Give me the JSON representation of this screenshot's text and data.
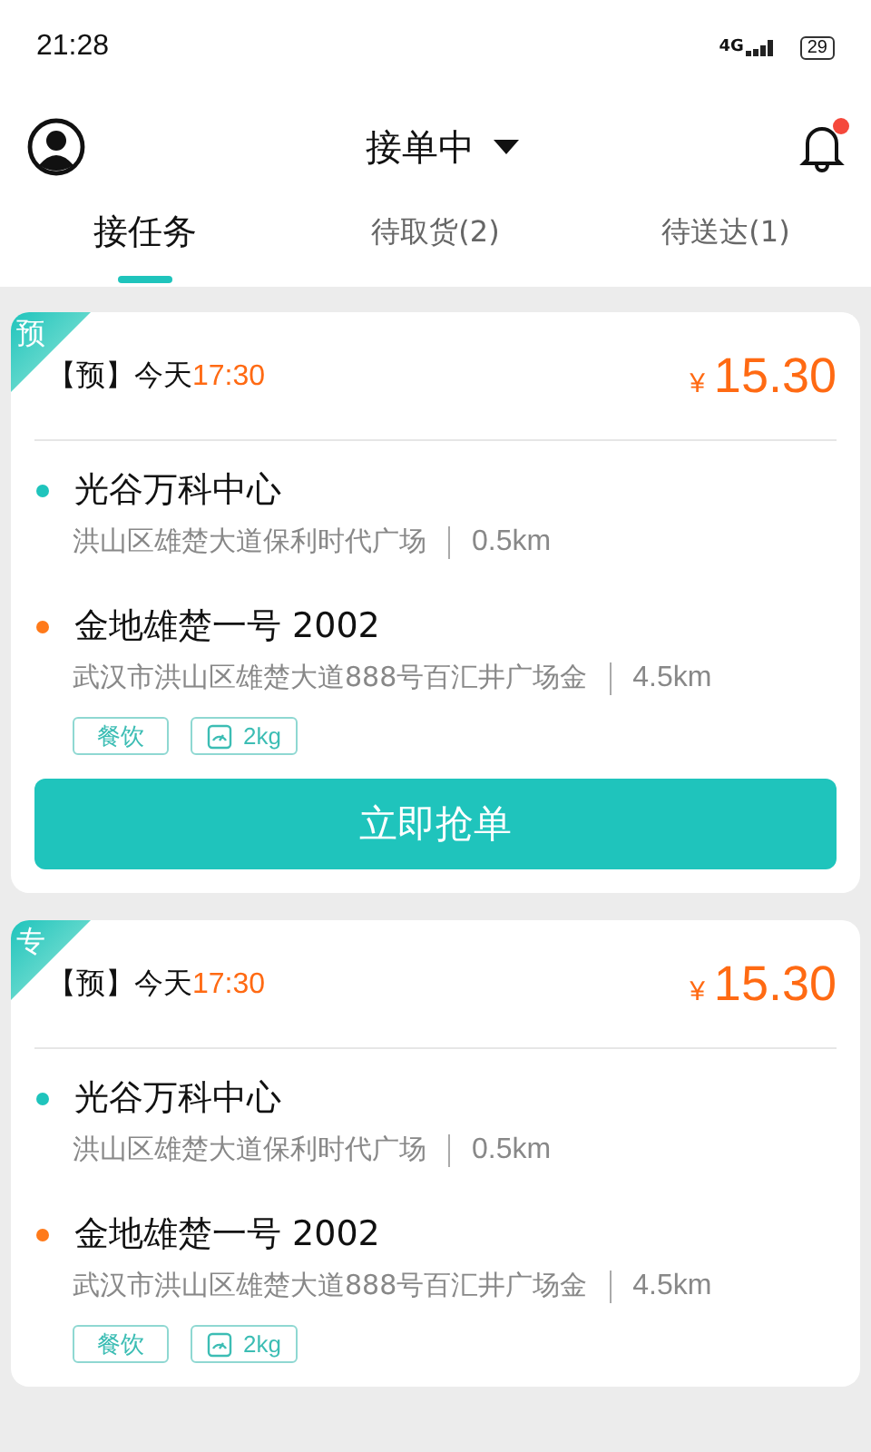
{
  "status_bar": {
    "time": "21:28",
    "network": "4G",
    "battery": "29"
  },
  "header": {
    "title": "接单中",
    "has_notification": true
  },
  "tabs": [
    {
      "label": "接任务",
      "selected": true
    },
    {
      "label": "待取货(2)",
      "selected": false
    },
    {
      "label": "待送达(1)",
      "selected": false
    }
  ],
  "orders": [
    {
      "corner_tag": "预",
      "schedule_tag": "【预】",
      "day": "今天",
      "time": "17:30",
      "currency": "¥",
      "price": "15.30",
      "pickup": {
        "name": "光谷万科中心",
        "address": "洪山区雄楚大道保利时代广场",
        "distance": "0.5km"
      },
      "dropoff": {
        "name": "金地雄楚一号 2002",
        "address": "武汉市洪山区雄楚大道888号百汇井广场金",
        "distance": "4.5km"
      },
      "tags": [
        {
          "kind": "category",
          "label": "餐饮"
        },
        {
          "kind": "weight",
          "label": "2kg"
        }
      ],
      "button": "立即抢单"
    },
    {
      "corner_tag": "专",
      "schedule_tag": "【预】",
      "day": "今天",
      "time": "17:30",
      "currency": "¥",
      "price": "15.30",
      "pickup": {
        "name": "光谷万科中心",
        "address": "洪山区雄楚大道保利时代广场",
        "distance": "0.5km"
      },
      "dropoff": {
        "name": "金地雄楚一号 2002",
        "address": "武汉市洪山区雄楚大道888号百汇井广场金",
        "distance": "4.5km"
      },
      "tags": [
        {
          "kind": "category",
          "label": "餐饮"
        },
        {
          "kind": "weight",
          "label": "2kg"
        }
      ]
    }
  ]
}
